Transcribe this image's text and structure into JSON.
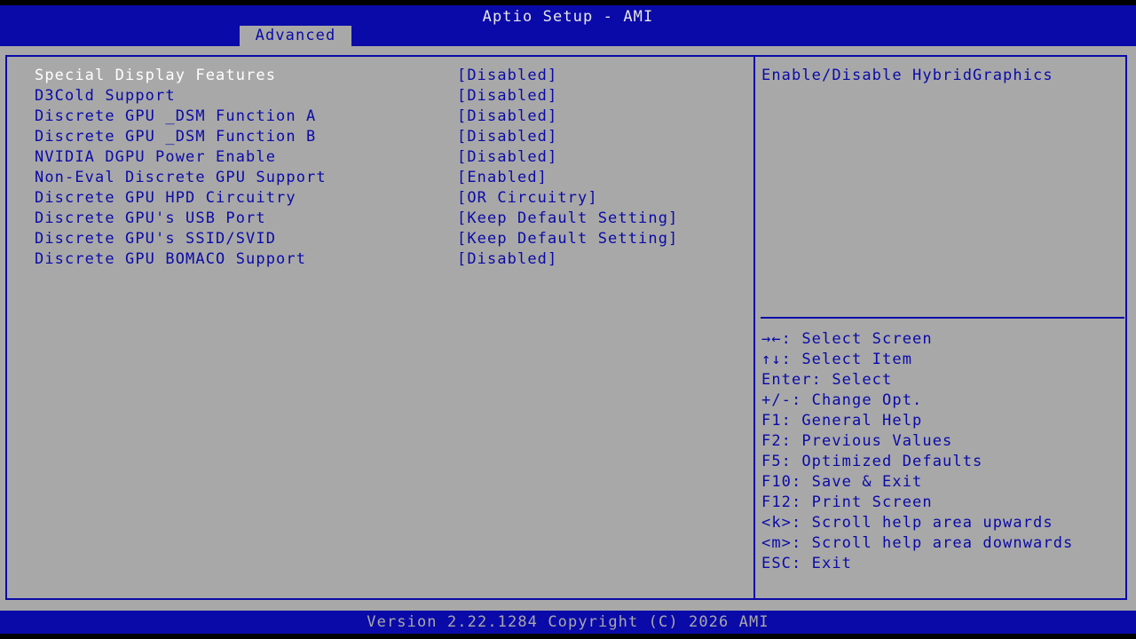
{
  "header": {
    "title": "Aptio Setup - AMI",
    "active_tab": "Advanced"
  },
  "settings": [
    {
      "label": "Special Display Features",
      "value": "[Disabled]"
    },
    {
      "label": "D3Cold Support",
      "value": "[Disabled]"
    },
    {
      "label": "Discrete GPU _DSM Function A",
      "value": "[Disabled]"
    },
    {
      "label": "Discrete GPU _DSM Function B",
      "value": "[Disabled]"
    },
    {
      "label": "NVIDIA DGPU Power Enable",
      "value": "[Disabled]"
    },
    {
      "label": "Non-Eval Discrete GPU Support",
      "value": "[Enabled]"
    },
    {
      "label": "Discrete GPU HPD Circuitry",
      "value": "[OR Circuitry]"
    },
    {
      "label": "Discrete GPU's USB Port",
      "value": "[Keep Default Setting]"
    },
    {
      "label": "Discrete GPU's SSID/SVID",
      "value": "[Keep Default Setting]"
    },
    {
      "label": "Discrete GPU BOMACO Support",
      "value": "[Disabled]"
    }
  ],
  "help": {
    "description": "Enable/Disable HybridGraphics"
  },
  "keys": [
    "→←: Select Screen",
    "↑↓: Select Item",
    "Enter: Select",
    "+/-: Change Opt.",
    "F1: General Help",
    "F2: Previous Values",
    "F5: Optimized Defaults",
    "F10: Save & Exit",
    "F12: Print Screen",
    "<k>: Scroll help area upwards",
    "<m>: Scroll help area downwards",
    "ESC: Exit"
  ],
  "footer": {
    "version": "Version 2.22.1284 Copyright (C) 2026 AMI"
  },
  "colors": {
    "bios_blue": "#0a0aa8",
    "bios_gray": "#a8a8a8",
    "selected_text": "#ffffff"
  }
}
